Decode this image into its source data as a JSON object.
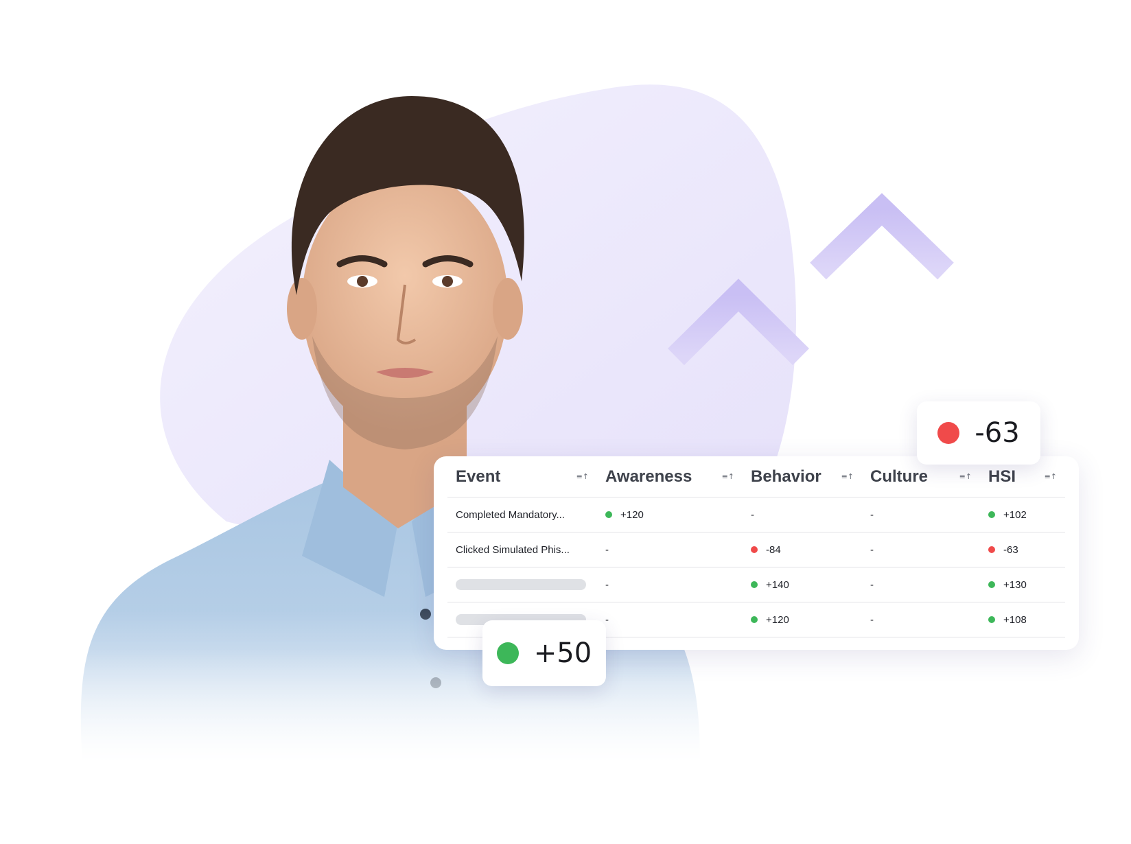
{
  "colors": {
    "blob": "#ece8fc",
    "arrow": "#cdc3f5",
    "positive": "#3db759",
    "negative": "#f04a4a"
  },
  "illustration": {
    "person": "smiling-man-in-denim-shirt",
    "arrows": "up-arrow-icon"
  },
  "table": {
    "headers": [
      {
        "label": "Event",
        "sort_icon": "sort-icon"
      },
      {
        "label": "Awareness",
        "sort_icon": "sort-icon"
      },
      {
        "label": "Behavior",
        "sort_icon": "sort-icon"
      },
      {
        "label": "Culture",
        "sort_icon": "sort-icon"
      },
      {
        "label": "HSI",
        "sort_icon": "sort-icon"
      }
    ],
    "rows": [
      {
        "event": "Completed Mandatory...",
        "awareness": "+120",
        "awareness_status": "positive",
        "behavior": "-",
        "behavior_status": "none",
        "culture": "-",
        "hsi": "+102",
        "hsi_status": "positive"
      },
      {
        "event": "Clicked Simulated Phis...",
        "awareness": "-",
        "awareness_status": "none",
        "behavior": "-84",
        "behavior_status": "negative",
        "culture": "-",
        "hsi": "-63",
        "hsi_status": "negative"
      },
      {
        "event": "",
        "awareness": "-",
        "awareness_status": "none",
        "behavior": "+140",
        "behavior_status": "positive",
        "culture": "-",
        "hsi": "+130",
        "hsi_status": "positive"
      },
      {
        "event": "",
        "awareness": "-",
        "awareness_status": "none",
        "behavior": "+120",
        "behavior_status": "positive",
        "culture": "-",
        "hsi": "+108",
        "hsi_status": "positive"
      }
    ]
  },
  "badges": {
    "negative": {
      "value": "-63",
      "status": "negative"
    },
    "positive": {
      "value": "+50",
      "status": "positive"
    }
  }
}
